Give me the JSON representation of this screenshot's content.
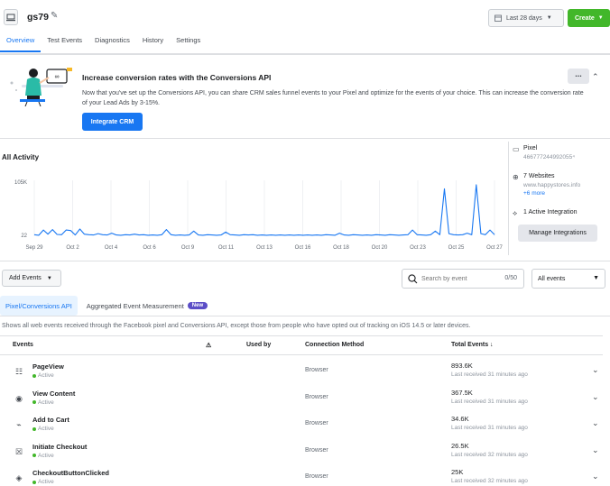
{
  "header": {
    "title": "gs79",
    "date_range": "Last 28 days",
    "create_label": "Create",
    "tabs": [
      {
        "label": "Overview",
        "active": true
      },
      {
        "label": "Test Events",
        "active": false
      },
      {
        "label": "Diagnostics",
        "active": false
      },
      {
        "label": "History",
        "active": false
      },
      {
        "label": "Settings",
        "active": false
      }
    ]
  },
  "promo": {
    "title": "Increase conversion rates with the Conversions API",
    "text": "Now that you've set up the Conversions API, you can share CRM sales funnel events to your Pixel and optimize for the events of your choice. This can increase the conversion rate of your Lead Ads by 3-15%.",
    "button_label": "Integrate CRM",
    "more_label": "..."
  },
  "activity": {
    "title": "All Activity"
  },
  "chart_data": {
    "type": "line",
    "ytick_labels": [
      "105K",
      "22"
    ],
    "ylim": [
      0,
      105000
    ],
    "xtick_labels": [
      "Sep 29",
      "Oct 2",
      "Oct 4",
      "Oct 6",
      "Oct 9",
      "Oct 11",
      "Oct 13",
      "Oct 16",
      "Oct 18",
      "Oct 20",
      "Oct 23",
      "Oct 25",
      "Oct 27"
    ],
    "grid": "vertical",
    "color": "#1877f2",
    "values": [
      3000,
      2000,
      12000,
      4000,
      13000,
      3500,
      3000,
      12000,
      11000,
      2500,
      14000,
      4000,
      3000,
      2500,
      5000,
      3000,
      2500,
      6000,
      2500,
      2000,
      3000,
      2500,
      4000,
      2500,
      3000,
      2000,
      2500,
      2000,
      3000,
      13000,
      3000,
      2000,
      2500,
      2000,
      2500,
      10000,
      2500,
      2000,
      3000,
      2500,
      2000,
      2500,
      8000,
      3000,
      2500,
      2000,
      3000,
      2500,
      3000,
      2000,
      2500,
      2000,
      2500,
      2000,
      2500,
      2000,
      2500,
      2000,
      2500,
      2000,
      2500,
      2000,
      2500,
      2000,
      3000,
      2500,
      2000,
      6000,
      2500,
      2000,
      3000,
      2500,
      2000,
      2500,
      2000,
      3000,
      2500,
      2000,
      3000,
      2500,
      2000,
      2500,
      3000,
      12000,
      3000,
      2500,
      2000,
      3000,
      10000,
      3000,
      92000,
      5000,
      3000,
      2500,
      3000,
      6000,
      3000,
      100000,
      5000,
      3000,
      12000,
      3000
    ]
  },
  "sidebar_panel": {
    "pixel_label": "Pixel",
    "pixel_id": "466777244992055⁴",
    "websites_label": "7 Websites",
    "website": "www.happystores.info",
    "more_link": "+6 more",
    "integration_label": "1 Active Integration",
    "manage_button": "Manage Integrations"
  },
  "filters": {
    "add_events_label": "Add Events",
    "search_placeholder": "Search by event",
    "search_count": "0/50",
    "all_events_label": "All events"
  },
  "subtabs": [
    {
      "label": "Pixel/Conversions API",
      "active": true
    },
    {
      "label": "Aggregated Event Measurement",
      "active": false,
      "badge": "New"
    }
  ],
  "description": "Shows all web events received through the Facebook pixel and Conversions API, except those from people who have opted out of tracking on iOS 14.5 or later devices.",
  "table": {
    "headers": {
      "events": "Events",
      "warning": "⚠",
      "used_by": "Used by",
      "connection_method": "Connection Method",
      "total_events": "Total Events ↓"
    },
    "rows": [
      {
        "icon": "page-icon",
        "glyph": "☷",
        "name": "PageView",
        "status": "Active",
        "method": "Browser",
        "total": "893.6K",
        "last": "Last received 31 minutes ago"
      },
      {
        "icon": "eye-icon",
        "glyph": "◉",
        "name": "View Content",
        "status": "Active",
        "method": "Browser",
        "total": "367.5K",
        "last": "Last received 31 minutes ago"
      },
      {
        "icon": "cart-icon",
        "glyph": "⌁",
        "name": "Add to Cart",
        "status": "Active",
        "method": "Browser",
        "total": "34.6K",
        "last": "Last received 31 minutes ago"
      },
      {
        "icon": "basket-icon",
        "glyph": "☒",
        "name": "Initiate Checkout",
        "status": "Active",
        "method": "Browser",
        "total": "26.5K",
        "last": "Last received 32 minutes ago"
      },
      {
        "icon": "tag-icon",
        "glyph": "◈",
        "name": "CheckoutButtonClicked",
        "status": "Active",
        "method": "Browser",
        "total": "25K",
        "last": "Last received 32 minutes ago"
      }
    ]
  }
}
